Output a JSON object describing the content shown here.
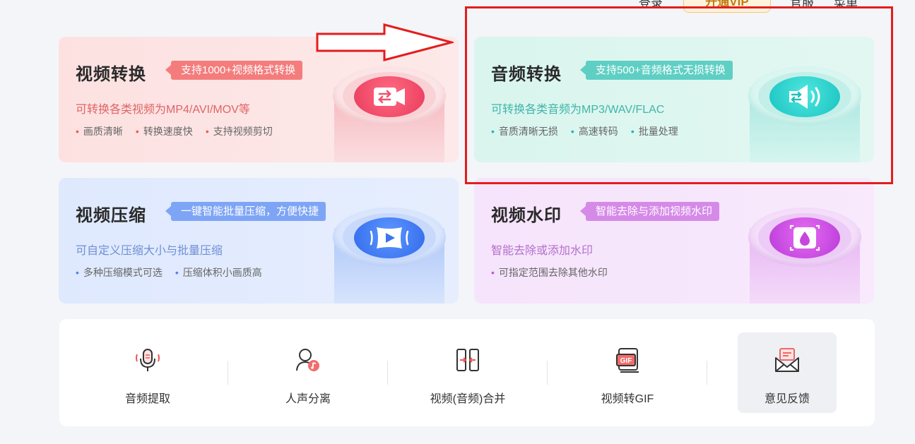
{
  "header": {
    "login_label": "登录",
    "vip_label": "开通VIP",
    "official_label": "官服",
    "menu_label": "菜单"
  },
  "cards": [
    {
      "title": "视频转换",
      "tag": "支持1000+视频格式转换",
      "desc": "可转换各类视频为MP4/AVI/MOV等",
      "features": [
        "画质清晰",
        "转换速度快",
        "支持视频剪切"
      ],
      "icon": "video-convert-icon",
      "color": "#f47c7c"
    },
    {
      "title": "音频转换",
      "tag": "支持500+音频格式无损转换",
      "desc": "可转换各类音频为MP3/WAV/FLAC",
      "features": [
        "音质清晰无损",
        "高速转码",
        "批量处理"
      ],
      "icon": "audio-convert-icon",
      "color": "#5fcfc4"
    },
    {
      "title": "视频压缩",
      "tag": "一键智能批量压缩，方便快捷",
      "desc": "可自定义压缩大小与批量压缩",
      "features": [
        "多种压缩模式可选",
        "压缩体积小画质高"
      ],
      "icon": "video-compress-icon",
      "color": "#7ea5f5"
    },
    {
      "title": "视频水印",
      "tag": "智能去除与添加视频水印",
      "desc": "智能去除或添加水印",
      "features": [
        "可指定范围去除其他水印"
      ],
      "icon": "watermark-icon",
      "color": "#d58ae8"
    }
  ],
  "tools": [
    {
      "label": "音频提取",
      "icon": "microphone-icon"
    },
    {
      "label": "人声分离",
      "icon": "voice-separate-icon"
    },
    {
      "label": "视频(音频)合并",
      "icon": "merge-icon"
    },
    {
      "label": "视频转GIF",
      "icon": "gif-icon"
    },
    {
      "label": "意见反馈",
      "icon": "feedback-mail-icon",
      "selected": true
    }
  ],
  "annotation": {
    "box_color": "#e31d1d"
  }
}
